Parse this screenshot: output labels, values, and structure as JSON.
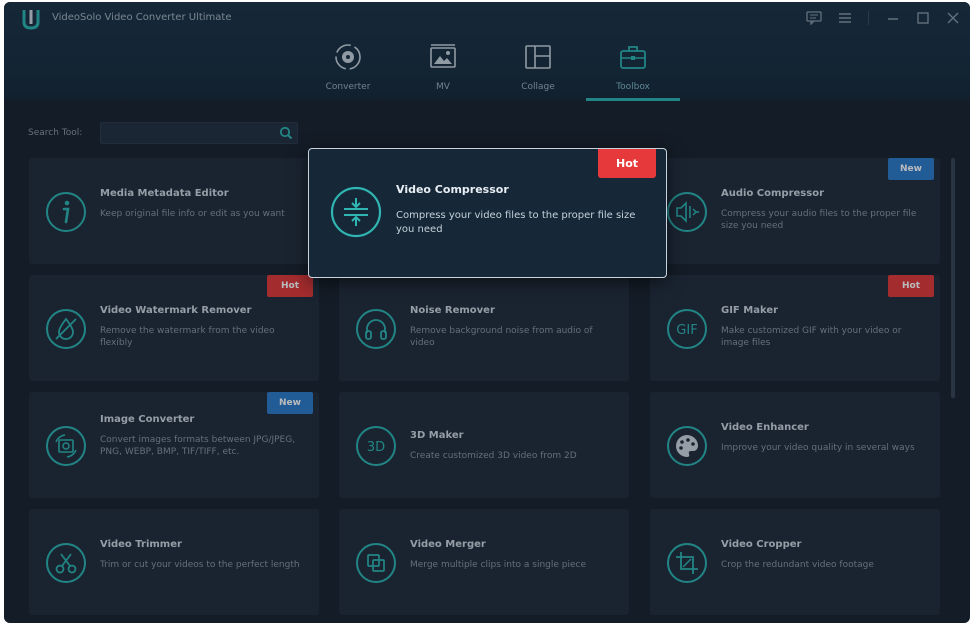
{
  "app": {
    "title": "VideoSolo Video Converter Ultimate"
  },
  "nav": {
    "tabs": [
      {
        "label": "Converter",
        "icon": "converter-icon"
      },
      {
        "label": "MV",
        "icon": "mv-icon"
      },
      {
        "label": "Collage",
        "icon": "collage-icon"
      },
      {
        "label": "Toolbox",
        "icon": "toolbox-icon",
        "active": true
      }
    ]
  },
  "search": {
    "label": "Search Tool:",
    "value": "",
    "placeholder": ""
  },
  "badges": {
    "hot": "Hot",
    "new": "New"
  },
  "colors": {
    "accent": "#2fb5b2",
    "hot": "#e13a3a",
    "new": "#2f7cc9"
  },
  "tools": [
    {
      "title": "Media Metadata Editor",
      "desc": "Keep original file info or edit as you want",
      "icon": "info-icon"
    },
    {
      "title": "Video Compressor",
      "desc": "Compress your video files to the proper file size you need",
      "icon": "compress-icon",
      "badge": "Hot"
    },
    {
      "title": "Audio Compressor",
      "desc": "Compress your audio files to the proper file size you need",
      "icon": "audio-compress-icon",
      "badge": "New"
    },
    {
      "title": "Video Watermark Remover",
      "desc": "Remove the watermark from the video flexibly",
      "icon": "watermark-off-icon",
      "badge": "Hot"
    },
    {
      "title": "Noise Remover",
      "desc": "Remove background noise from audio of video",
      "icon": "headphones-icon"
    },
    {
      "title": "GIF Maker",
      "desc": "Make customized GIF with your video or image files",
      "icon": "gif-icon",
      "badge": "Hot"
    },
    {
      "title": "Image Converter",
      "desc": "Convert images formats between JPG/JPEG, PNG, WEBP, BMP, TIF/TIFF, etc.",
      "icon": "image-convert-icon",
      "badge": "New"
    },
    {
      "title": "3D Maker",
      "desc": "Create customized 3D video from 2D",
      "icon": "3d-icon"
    },
    {
      "title": "Video Enhancer",
      "desc": "Improve your video quality in several ways",
      "icon": "palette-icon"
    },
    {
      "title": "Video Trimmer",
      "desc": "Trim or cut your videos to the perfect length",
      "icon": "scissors-icon"
    },
    {
      "title": "Video Merger",
      "desc": "Merge multiple clips into a single piece",
      "icon": "merge-icon"
    },
    {
      "title": "Video Cropper",
      "desc": "Crop the redundant video footage",
      "icon": "crop-icon"
    }
  ]
}
